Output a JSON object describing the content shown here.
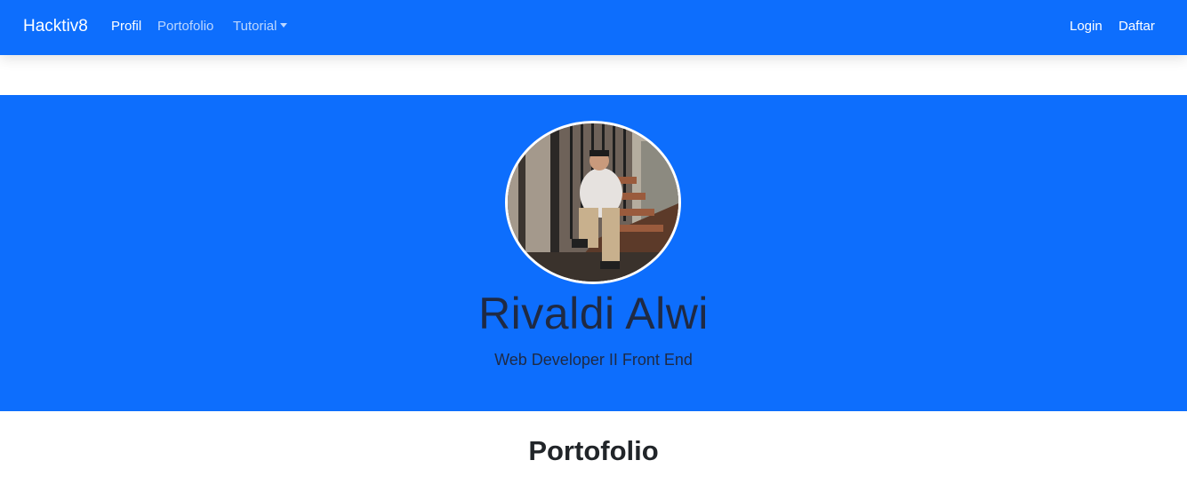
{
  "navbar": {
    "brand": "Hacktiv8",
    "links": [
      {
        "label": "Profil",
        "active": true
      },
      {
        "label": "Portofolio",
        "active": false
      },
      {
        "label": "Tutorial",
        "active": false,
        "dropdown": true
      }
    ],
    "right_links": [
      {
        "label": "Login"
      },
      {
        "label": "Daftar"
      }
    ],
    "background_color": "#0d6efd"
  },
  "hero": {
    "name": "Rivaldi Alwi",
    "role": "Web Developer II Front End",
    "avatar_alt": "profile-photo",
    "background_color": "#0d6efd"
  },
  "sections": {
    "portfolio_title": "Portofolio"
  }
}
